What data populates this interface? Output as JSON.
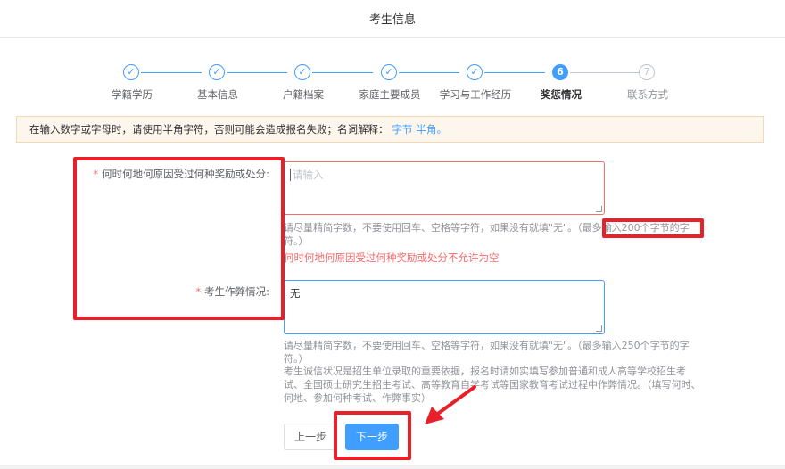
{
  "header": {
    "title": "考生信息"
  },
  "steps": [
    {
      "label": "学籍学历",
      "status": "done",
      "icon": "check-icon"
    },
    {
      "label": "基本信息",
      "status": "done",
      "icon": "check-icon"
    },
    {
      "label": "户籍档案",
      "status": "done",
      "icon": "check-icon"
    },
    {
      "label": "家庭主要成员",
      "status": "done",
      "icon": "check-icon"
    },
    {
      "label": "学习与工作经历",
      "status": "done",
      "icon": "check-icon"
    },
    {
      "label": "奖惩情况",
      "status": "current",
      "number": "6"
    },
    {
      "label": "联系方式",
      "status": "todo",
      "number": "7"
    }
  ],
  "notice": {
    "text": "在输入数字或字母时，请使用半角字符，否则可能会造成报名失败；名词解释：",
    "link1": "字节",
    "link2": "半角。"
  },
  "form": {
    "reward": {
      "label": "何时何地何原因受过何种奖励或处分:",
      "placeholder": "请输入",
      "value": "",
      "hint": "请尽量精简字数，不要使用回车、空格等字符，如果没有就填\"无\"。（最多输入200个字节的字符。）",
      "error": "何时何地何原因受过何种奖励或处分不允许为空"
    },
    "cheating": {
      "label": "考生作弊情况:",
      "value": "无",
      "hint": "请尽量精简字数，不要使用回车、空格等字符，如果没有就填\"无\"。（最多输入250个字节的字符。）",
      "note": "考生诚信状况是招生单位录取的重要依据，报名时请如实填写参加普通和成人高等学校招生考试、全国硕士研究生招生考试、高等教育自学考试等国家教育考试过程中作弊情况。（填写何时、何地、参加何种考试、作弊事实）"
    }
  },
  "buttons": {
    "prev": "上一步",
    "next": "下一步"
  },
  "colors": {
    "primary": "#409eff",
    "error": "#f56c6c",
    "annotation": "#e8202a"
  }
}
